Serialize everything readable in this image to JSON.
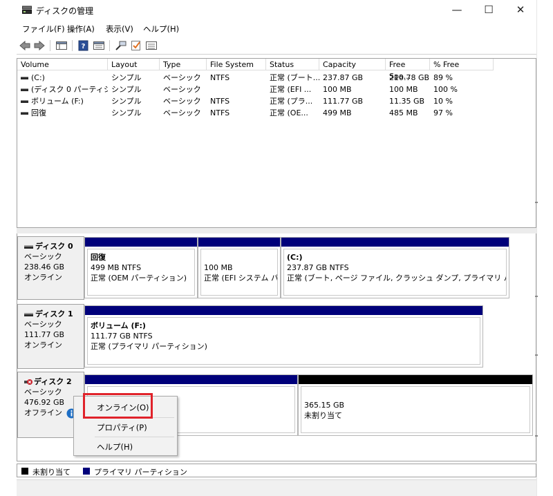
{
  "window": {
    "title": "ディスクの管理",
    "minimize": "—",
    "maximize": "☐",
    "close": "✕"
  },
  "menu": [
    "ファイル(F)",
    "操作(A)",
    "表示(V)",
    "ヘルプ(H)"
  ],
  "toolbar": {
    "icons": [
      "back-icon",
      "forward-icon",
      "console-view-icon",
      "help-icon",
      "properties-icon",
      "connect-icon",
      "check-icon",
      "list-icon"
    ]
  },
  "volume_table": {
    "columns": [
      "Volume",
      "Layout",
      "Type",
      "File System",
      "Status",
      "Capacity",
      "Free Spa...",
      "% Free"
    ],
    "rows": [
      [
        "(C:)",
        "シンプル",
        "ベーシック",
        "NTFS",
        "正常 (ブート...",
        "237.87 GB",
        "210.78 GB",
        "89 %"
      ],
      [
        "(ディスク 0 パーティシ...",
        "シンプル",
        "ベーシック",
        "",
        "正常 (EFI ...",
        "100 MB",
        "100 MB",
        "100 %"
      ],
      [
        "ボリューム (F:)",
        "シンプル",
        "ベーシック",
        "NTFS",
        "正常 (プラ...",
        "111.77 GB",
        "11.35 GB",
        "10 %"
      ],
      [
        "回復",
        "シンプル",
        "ベーシック",
        "NTFS",
        "正常 (OE...",
        "499 MB",
        "485 MB",
        "97 %"
      ]
    ]
  },
  "disks": [
    {
      "name": "ディスク 0",
      "type": "ベーシック",
      "size": "238.46 GB",
      "status": "オンライン",
      "partitions": [
        {
          "title": "回復",
          "size": "499 MB NTFS",
          "status": "正常 (OEM パーティション)"
        },
        {
          "title": "",
          "size": "100 MB",
          "status": "正常 (EFI システム パー"
        },
        {
          "title": "(C:)",
          "size": "237.87 GB NTFS",
          "status": "正常 (ブート, ページ ファイル, クラッシュ ダンプ, プライマリ パーティション)"
        }
      ]
    },
    {
      "name": "ディスク 1",
      "type": "ベーシック",
      "size": "111.77 GB",
      "status": "オンライン",
      "partitions": [
        {
          "title": "ボリューム  (F:)",
          "size": "111.77 GB NTFS",
          "status": "正常 (プライマリ パーティション)"
        }
      ]
    },
    {
      "name": "ディスク 2",
      "type": "ベーシック",
      "size": "476.92 GB",
      "status": "オフライン",
      "partitions": [
        {
          "title": "",
          "size": "",
          "status": ""
        },
        {
          "title": "",
          "size": "365.15 GB",
          "status": "未割り当て"
        }
      ]
    }
  ],
  "context_menu": {
    "items": [
      "オンライン(O)",
      "プロパティ(P)",
      "ヘルプ(H)"
    ]
  },
  "legend": {
    "unallocated": "未割り当て",
    "primary": "プライマリ パーティション"
  },
  "colors": {
    "primary_partition": "#00007a",
    "unallocated": "#000000",
    "highlight": "#e0222a",
    "info_badge": "#1f6fc5",
    "offline_badge": "#c8202a"
  }
}
